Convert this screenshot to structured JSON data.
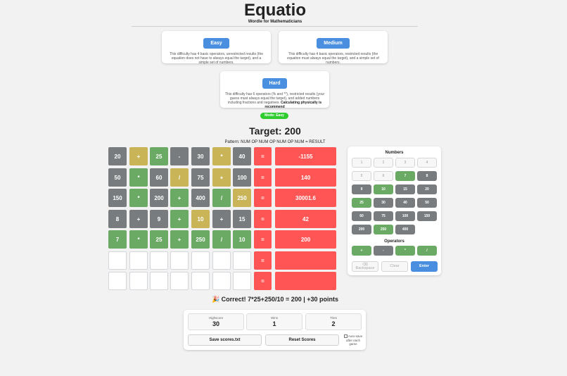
{
  "header": {
    "title": "Equatio",
    "subtitle": "Wordle for Mathematicians"
  },
  "difficulties": [
    {
      "label": "Easy",
      "description": "This difficulty has 4 basic operators, unrestricted results (the equation does not have to always equal the target), and a simple set of numbers."
    },
    {
      "label": "Medium",
      "description": "This difficulty has 4 basic operators, restricted results (the equation must always equal the target), and a simple set of numbers."
    },
    {
      "label": "Hard",
      "description": "This difficulty has 6 operators (% and **), restricted results (your guess must always equal the target), and added numbers including fractions and negatives.",
      "description_bold": "Calculating physically is recommend"
    }
  ],
  "mode_badge": "Mode: Easy",
  "target_text": "Target: 200",
  "pattern_text": "Pattern: NUM OP NUM OP NUM OP NUM = RESULT",
  "colors": {
    "gray": "#787c7e",
    "yellow": "#c9b458",
    "green": "#6aaa64",
    "red": "#ff5555",
    "blue": "#4a8fdf",
    "badge": "#2ecc2e"
  },
  "board": {
    "equals_symbol": "=",
    "rows": [
      {
        "tiles": [
          {
            "v": "20",
            "s": "gray"
          },
          {
            "v": "+",
            "s": "yellow"
          },
          {
            "v": "25",
            "s": "green"
          },
          {
            "v": "-",
            "s": "gray"
          },
          {
            "v": "30",
            "s": "gray"
          },
          {
            "v": "*",
            "s": "yellow"
          },
          {
            "v": "40",
            "s": "gray"
          }
        ],
        "result": "-1155"
      },
      {
        "tiles": [
          {
            "v": "50",
            "s": "gray"
          },
          {
            "v": "*",
            "s": "green"
          },
          {
            "v": "60",
            "s": "gray"
          },
          {
            "v": "/",
            "s": "yellow"
          },
          {
            "v": "75",
            "s": "gray"
          },
          {
            "v": "+",
            "s": "yellow"
          },
          {
            "v": "100",
            "s": "gray"
          }
        ],
        "result": "140"
      },
      {
        "tiles": [
          {
            "v": "150",
            "s": "gray"
          },
          {
            "v": "*",
            "s": "green"
          },
          {
            "v": "200",
            "s": "gray"
          },
          {
            "v": "+",
            "s": "green"
          },
          {
            "v": "400",
            "s": "gray"
          },
          {
            "v": "/",
            "s": "green"
          },
          {
            "v": "250",
            "s": "yellow"
          }
        ],
        "result": "30001.6"
      },
      {
        "tiles": [
          {
            "v": "8",
            "s": "gray"
          },
          {
            "v": "+",
            "s": "gray"
          },
          {
            "v": "9",
            "s": "gray"
          },
          {
            "v": "+",
            "s": "green"
          },
          {
            "v": "10",
            "s": "yellow"
          },
          {
            "v": "+",
            "s": "gray"
          },
          {
            "v": "15",
            "s": "gray"
          }
        ],
        "result": "42"
      },
      {
        "tiles": [
          {
            "v": "7",
            "s": "green"
          },
          {
            "v": "*",
            "s": "green"
          },
          {
            "v": "25",
            "s": "green"
          },
          {
            "v": "+",
            "s": "green"
          },
          {
            "v": "250",
            "s": "green"
          },
          {
            "v": "/",
            "s": "green"
          },
          {
            "v": "10",
            "s": "green"
          }
        ],
        "result": "200"
      },
      {
        "tiles": [
          {
            "v": "",
            "s": "empty"
          },
          {
            "v": "",
            "s": "empty"
          },
          {
            "v": "",
            "s": "empty"
          },
          {
            "v": "",
            "s": "empty"
          },
          {
            "v": "",
            "s": "empty"
          },
          {
            "v": "",
            "s": "empty"
          },
          {
            "v": "",
            "s": "empty"
          }
        ],
        "result": ""
      },
      {
        "tiles": [
          {
            "v": "",
            "s": "empty"
          },
          {
            "v": "",
            "s": "empty"
          },
          {
            "v": "",
            "s": "empty"
          },
          {
            "v": "",
            "s": "empty"
          },
          {
            "v": "",
            "s": "empty"
          },
          {
            "v": "",
            "s": "empty"
          },
          {
            "v": "",
            "s": "empty"
          }
        ],
        "result": ""
      }
    ]
  },
  "keyboard": {
    "numbers_title": "Numbers",
    "numbers": [
      {
        "v": "1",
        "s": "unused"
      },
      {
        "v": "2",
        "s": "unused"
      },
      {
        "v": "3",
        "s": "unused"
      },
      {
        "v": "4",
        "s": "unused"
      },
      {
        "v": "5",
        "s": "unused"
      },
      {
        "v": "6",
        "s": "unused"
      },
      {
        "v": "7",
        "s": "green"
      },
      {
        "v": "8",
        "s": "gray"
      },
      {
        "v": "9",
        "s": "gray"
      },
      {
        "v": "10",
        "s": "green"
      },
      {
        "v": "15",
        "s": "gray"
      },
      {
        "v": "20",
        "s": "gray"
      },
      {
        "v": "25",
        "s": "green"
      },
      {
        "v": "30",
        "s": "gray"
      },
      {
        "v": "40",
        "s": "gray"
      },
      {
        "v": "50",
        "s": "gray"
      },
      {
        "v": "60",
        "s": "gray"
      },
      {
        "v": "75",
        "s": "gray"
      },
      {
        "v": "100",
        "s": "gray"
      },
      {
        "v": "150",
        "s": "gray"
      },
      {
        "v": "200",
        "s": "gray"
      },
      {
        "v": "250",
        "s": "green"
      },
      {
        "v": "400",
        "s": "gray"
      }
    ],
    "operators_title": "Operators",
    "operators": [
      {
        "v": "+",
        "s": "green"
      },
      {
        "v": "-",
        "s": "gray"
      },
      {
        "v": "*",
        "s": "green"
      },
      {
        "v": "/",
        "s": "green"
      }
    ],
    "backspace_label": "⌫ Backspace",
    "clear_label": "Clear",
    "enter_label": "Enter"
  },
  "result_message": "🎉 Correct! 7*25+250/10 = 200 | +30 points",
  "scores": {
    "highscore_label": "Highscore",
    "highscore": "30",
    "wins_label": "Wins",
    "wins": "1",
    "tries_label": "Tries",
    "tries": "2",
    "save_label": "Save scores.txt",
    "reset_label": "Reset Scores",
    "autosave_label": "Auto-save after each game"
  }
}
